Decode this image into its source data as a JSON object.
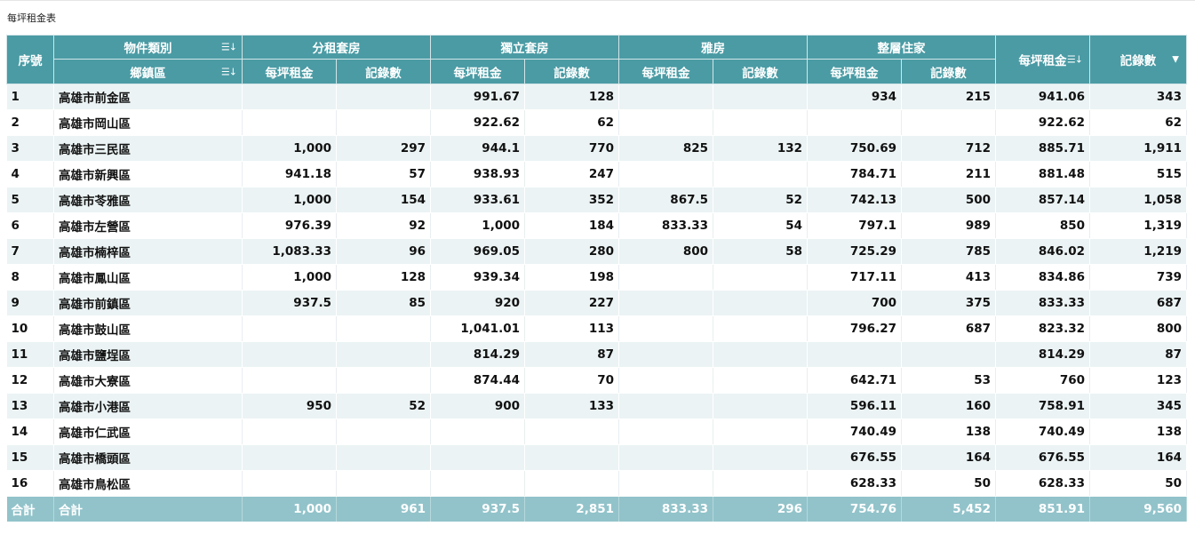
{
  "title": "每坪租金表",
  "header": {
    "index": "序號",
    "category": "物件類別",
    "district": "鄉鎮區",
    "groups": [
      "分租套房",
      "獨立套房",
      "雅房",
      "整層住家"
    ],
    "rent": "每坪租金",
    "count": "記錄數",
    "total_rent": "每坪租金",
    "total_count": "記錄數",
    "sort_icon": "sort-icon",
    "filter_icon": "filter-icon"
  },
  "rows": [
    [
      "1",
      "高雄市前金區",
      "",
      "",
      "991.67",
      "128",
      "",
      "",
      "934",
      "215",
      "941.06",
      "343"
    ],
    [
      "2",
      "高雄市岡山區",
      "",
      "",
      "922.62",
      "62",
      "",
      "",
      "",
      "",
      "922.62",
      "62"
    ],
    [
      "3",
      "高雄市三民區",
      "1,000",
      "297",
      "944.1",
      "770",
      "825",
      "132",
      "750.69",
      "712",
      "885.71",
      "1,911"
    ],
    [
      "4",
      "高雄市新興區",
      "941.18",
      "57",
      "938.93",
      "247",
      "",
      "",
      "784.71",
      "211",
      "881.48",
      "515"
    ],
    [
      "5",
      "高雄市苓雅區",
      "1,000",
      "154",
      "933.61",
      "352",
      "867.5",
      "52",
      "742.13",
      "500",
      "857.14",
      "1,058"
    ],
    [
      "6",
      "高雄市左營區",
      "976.39",
      "92",
      "1,000",
      "184",
      "833.33",
      "54",
      "797.1",
      "989",
      "850",
      "1,319"
    ],
    [
      "7",
      "高雄市楠梓區",
      "1,083.33",
      "96",
      "969.05",
      "280",
      "800",
      "58",
      "725.29",
      "785",
      "846.02",
      "1,219"
    ],
    [
      "8",
      "高雄市鳳山區",
      "1,000",
      "128",
      "939.34",
      "198",
      "",
      "",
      "717.11",
      "413",
      "834.86",
      "739"
    ],
    [
      "9",
      "高雄市前鎮區",
      "937.5",
      "85",
      "920",
      "227",
      "",
      "",
      "700",
      "375",
      "833.33",
      "687"
    ],
    [
      "10",
      "高雄市鼓山區",
      "",
      "",
      "1,041.01",
      "113",
      "",
      "",
      "796.27",
      "687",
      "823.32",
      "800"
    ],
    [
      "11",
      "高雄市鹽埕區",
      "",
      "",
      "814.29",
      "87",
      "",
      "",
      "",
      "",
      "814.29",
      "87"
    ],
    [
      "12",
      "高雄市大寮區",
      "",
      "",
      "874.44",
      "70",
      "",
      "",
      "642.71",
      "53",
      "760",
      "123"
    ],
    [
      "13",
      "高雄市小港區",
      "950",
      "52",
      "900",
      "133",
      "",
      "",
      "596.11",
      "160",
      "758.91",
      "345"
    ],
    [
      "14",
      "高雄市仁武區",
      "",
      "",
      "",
      "",
      "",
      "",
      "740.49",
      "138",
      "740.49",
      "138"
    ],
    [
      "15",
      "高雄市橋頭區",
      "",
      "",
      "",
      "",
      "",
      "",
      "676.55",
      "164",
      "676.55",
      "164"
    ],
    [
      "16",
      "高雄市鳥松區",
      "",
      "",
      "",
      "",
      "",
      "",
      "628.33",
      "50",
      "628.33",
      "50"
    ]
  ],
  "footer": [
    "合計",
    "合計",
    "1,000",
    "961",
    "937.5",
    "2,851",
    "833.33",
    "296",
    "754.76",
    "5,452",
    "851.91",
    "9,560"
  ]
}
